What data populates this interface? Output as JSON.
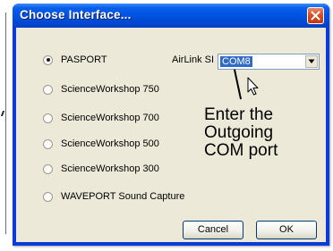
{
  "window": {
    "title": "Choose Interface..."
  },
  "interfaces": [
    {
      "label": "PASPORT",
      "selected": true
    },
    {
      "label": "ScienceWorkshop 750",
      "selected": false
    },
    {
      "label": "ScienceWorkshop 700",
      "selected": false
    },
    {
      "label": "ScienceWorkshop 500",
      "selected": false
    },
    {
      "label": "ScienceWorkshop 300",
      "selected": false
    },
    {
      "label": "WAVEPORT Sound Capture",
      "selected": false
    }
  ],
  "airlink": {
    "label": "AirLink SI",
    "port_value": "COM8"
  },
  "annotation": {
    "line1": "Enter the",
    "line2": "Outgoing",
    "line3": "COM port"
  },
  "buttons": {
    "cancel": "Cancel",
    "ok": "OK"
  },
  "colors": {
    "title_bar": "#0054e3",
    "client_bg": "#ece9d8",
    "selection": "#316ac5",
    "close_button": "#d2481f"
  },
  "icons": {
    "close": "close-icon",
    "dropdown": "chevron-down-icon",
    "cursor": "mouse-cursor-icon"
  }
}
